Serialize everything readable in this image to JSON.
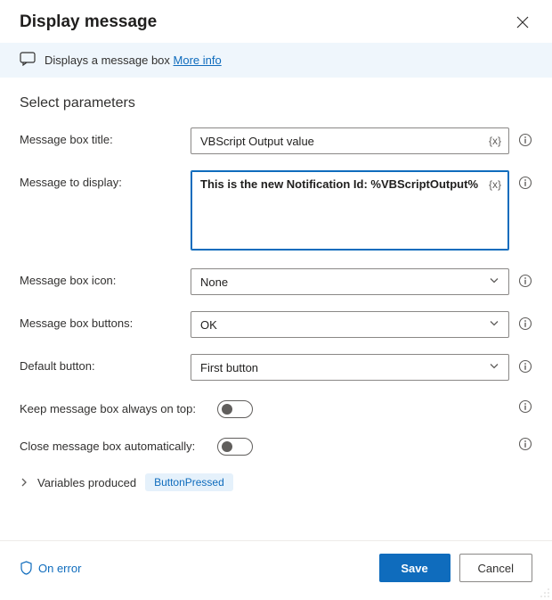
{
  "dialog": {
    "title": "Display message",
    "info_text": "Displays a message box ",
    "more_info": "More info"
  },
  "section": {
    "title": "Select parameters"
  },
  "fields": {
    "title": {
      "label": "Message box title:",
      "value": "VBScript Output value",
      "var_hint": "{x}"
    },
    "message": {
      "label": "Message to display:",
      "value": "This is the new Notification Id: %VBScriptOutput%",
      "var_hint": "{x}"
    },
    "icon": {
      "label": "Message box icon:",
      "value": "None"
    },
    "buttons": {
      "label": "Message box buttons:",
      "value": "OK"
    },
    "default_btn": {
      "label": "Default button:",
      "value": "First button"
    },
    "always_on_top": {
      "label": "Keep message box always on top:",
      "value": false
    },
    "auto_close": {
      "label": "Close message box automatically:",
      "value": false
    }
  },
  "variables": {
    "label": "Variables produced",
    "chip": "ButtonPressed"
  },
  "footer": {
    "on_error": "On error",
    "save": "Save",
    "cancel": "Cancel"
  }
}
